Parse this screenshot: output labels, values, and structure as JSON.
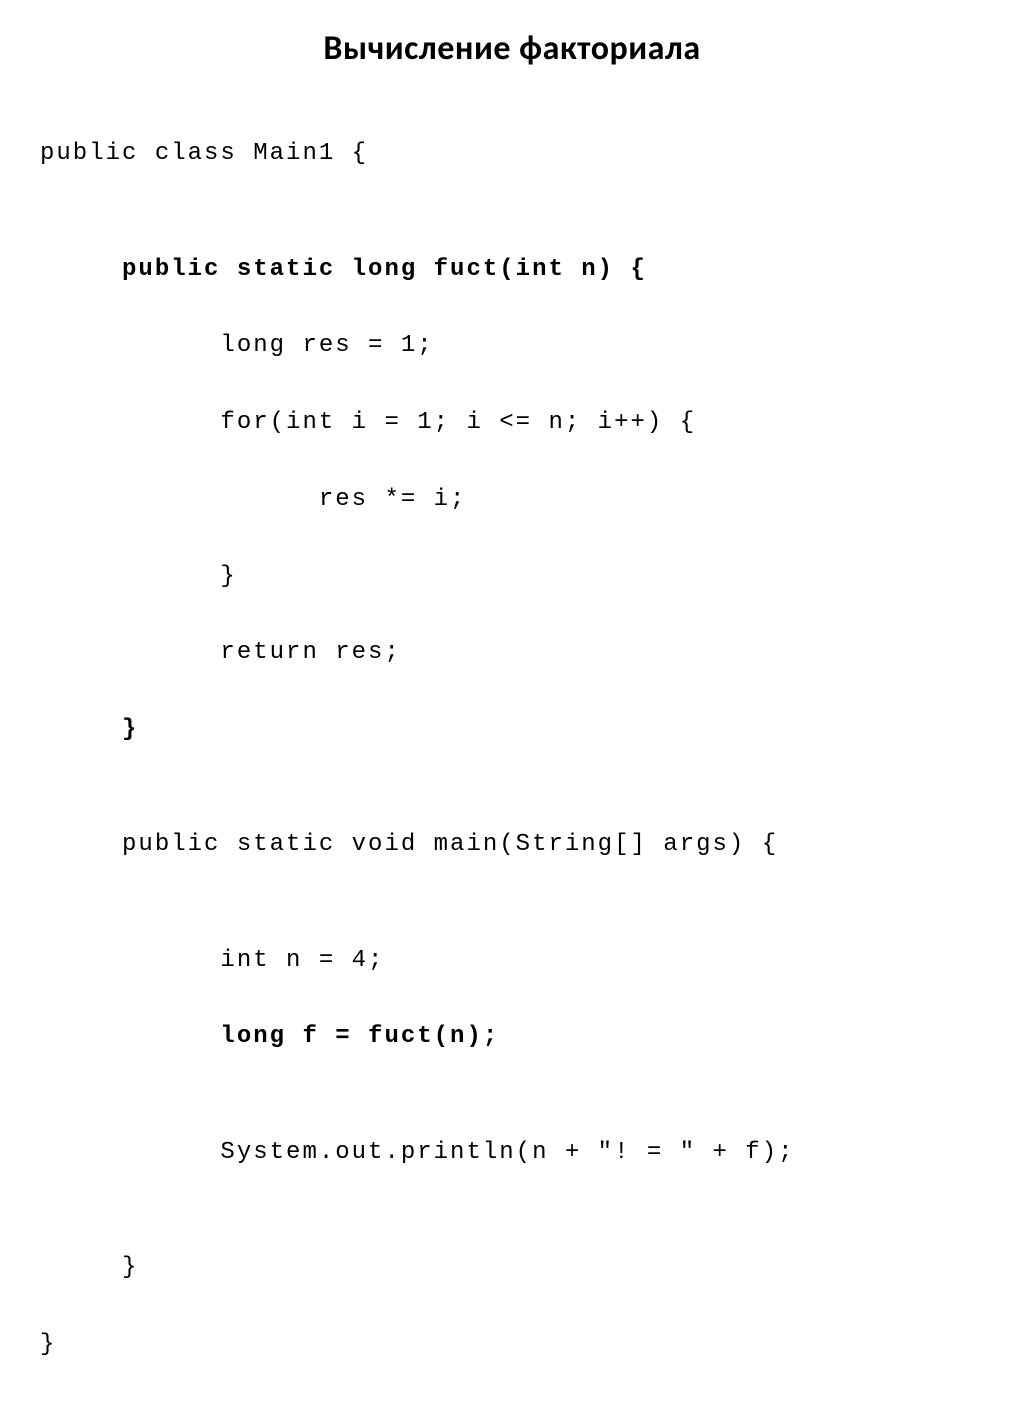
{
  "title": "Вычисление факториала",
  "code": {
    "l1": "public class Main1 {",
    "l2": "",
    "l3": "     public static long fuct(int n) {",
    "l4": "           long res = 1;",
    "l5": "           for(int i = 1; i <= n; i++) {",
    "l6": "                 res *= i;",
    "l7": "           }",
    "l8": "           return res;",
    "l9": "     }",
    "l10": "",
    "l11": "     public static void main(String[] args) {",
    "l12": "",
    "l13": "           int n = 4;",
    "l14": "           long f = fuct(n);",
    "l15": "",
    "l16": "           System.out.println(n + \"! = \" + f);",
    "l17": "",
    "l18": "     }",
    "l19": "}"
  }
}
